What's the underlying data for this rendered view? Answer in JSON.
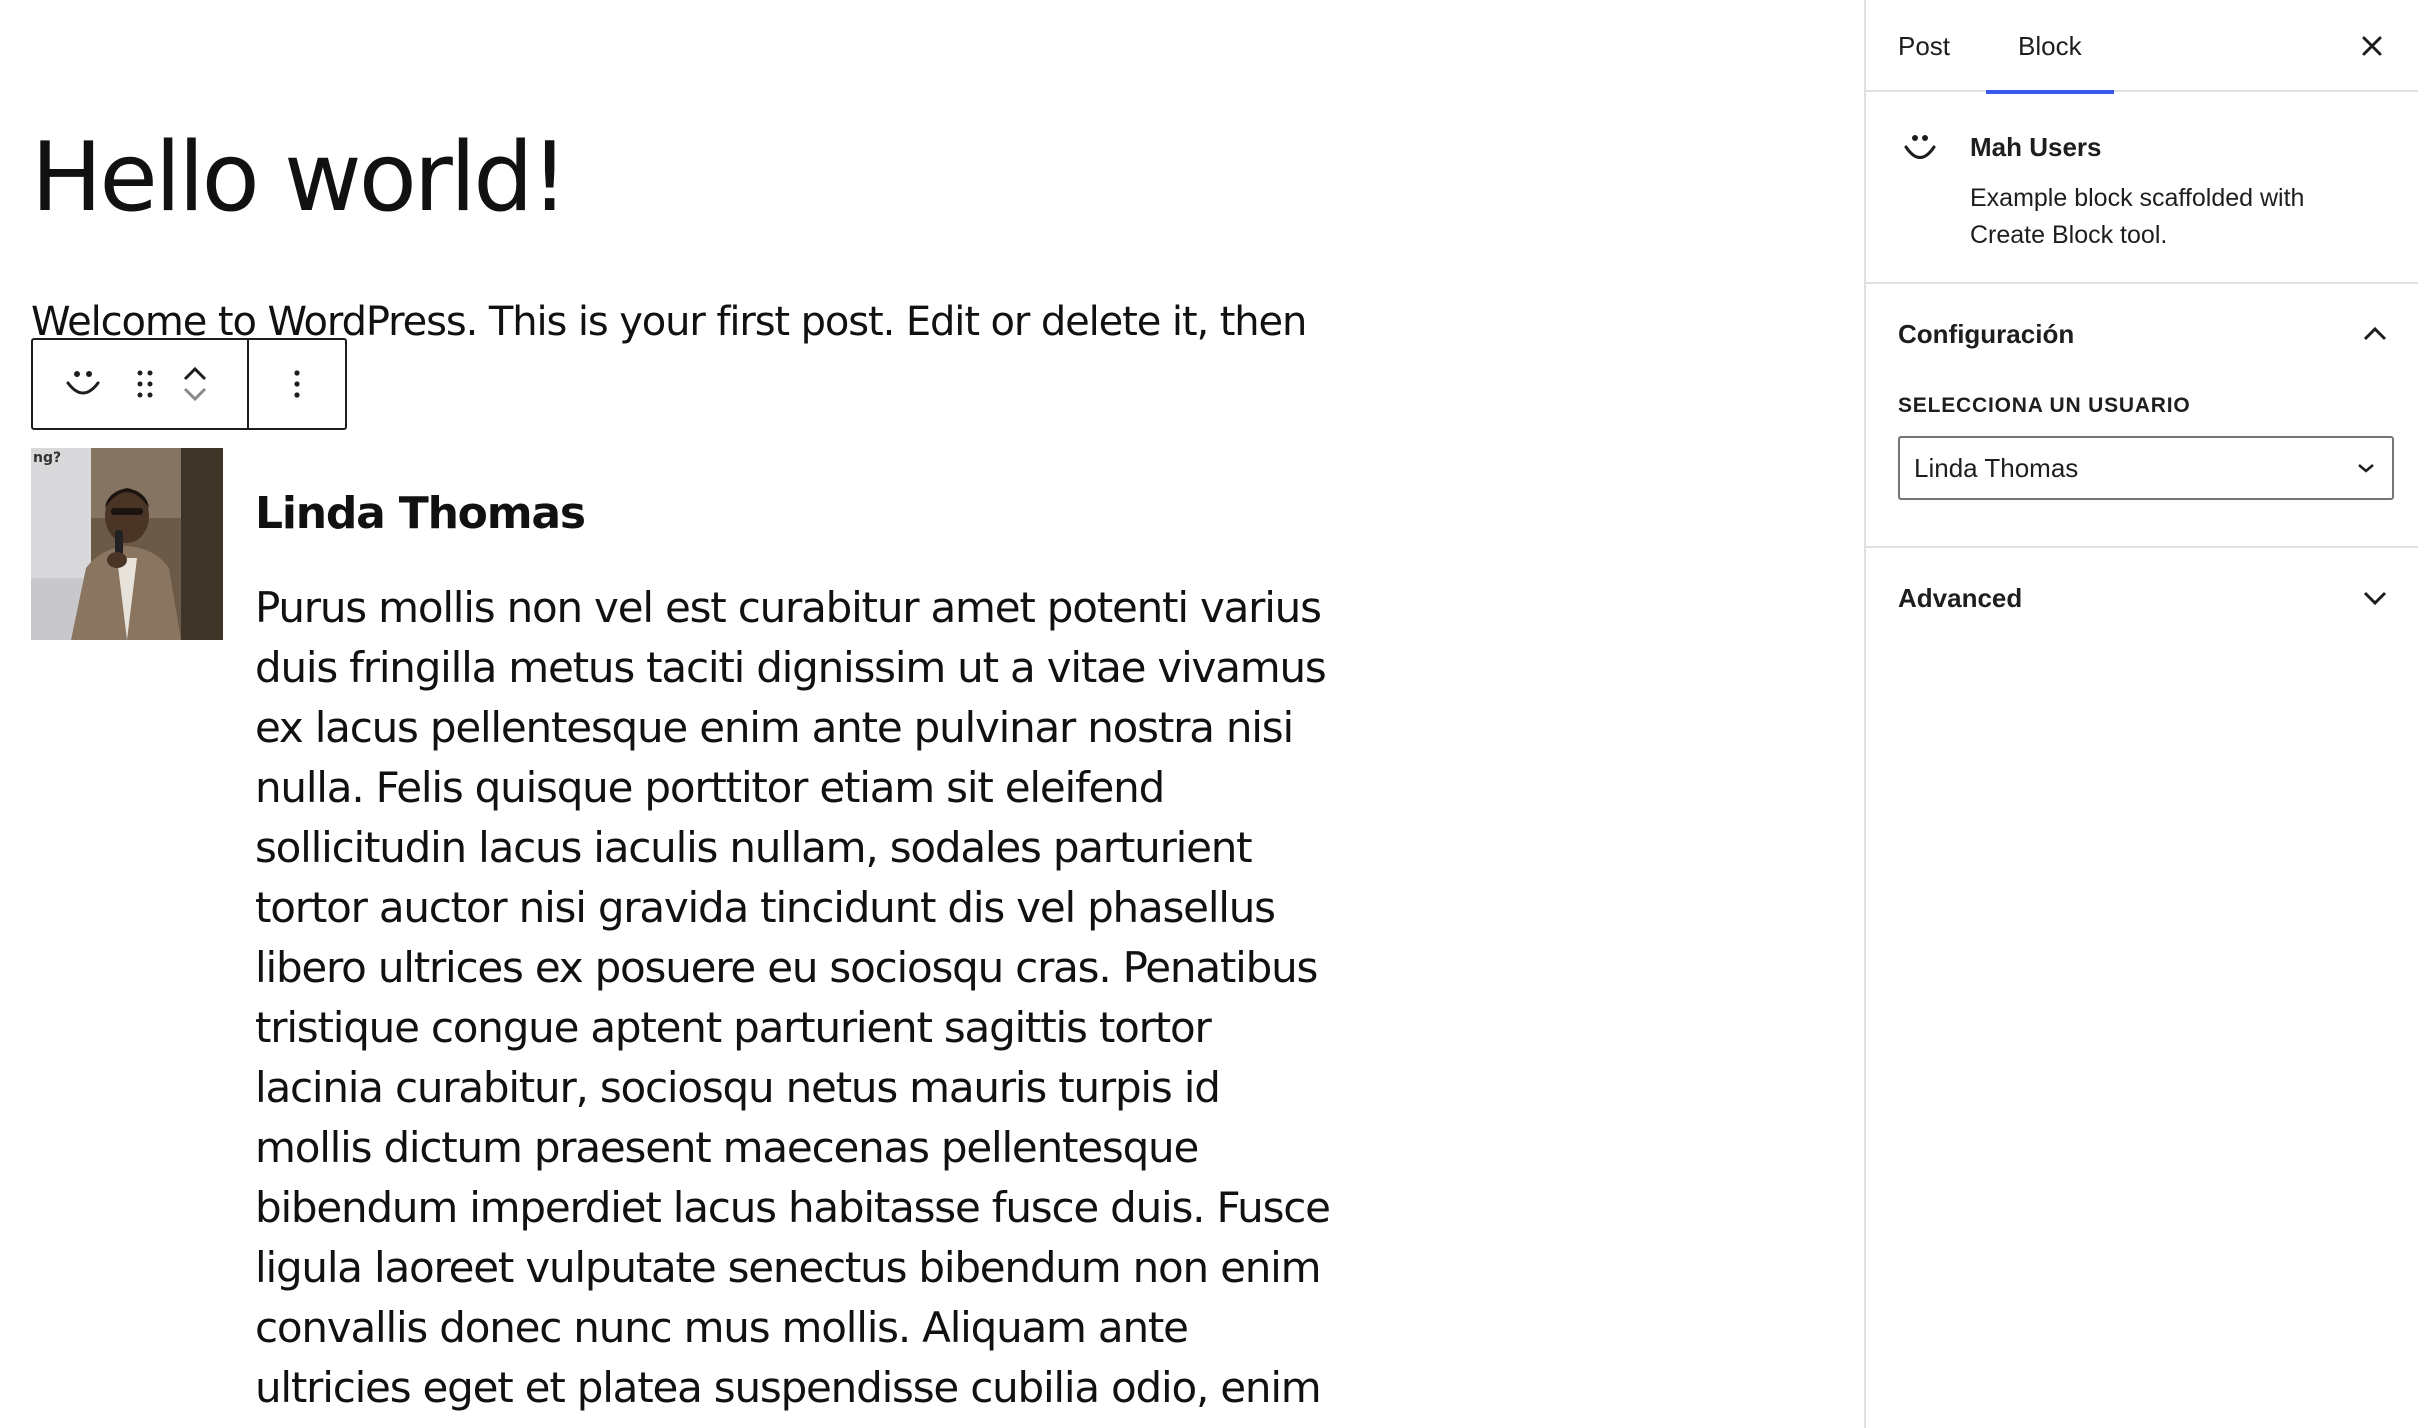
{
  "post": {
    "title": "Hello world!",
    "intro": "Welcome to WordPress. This is your first post. Edit or delete it, then"
  },
  "user_block": {
    "name": "Linda Thomas",
    "bio": "Purus mollis non vel est curabitur amet potenti varius duis fringilla metus taciti dignissim ut a vitae vivamus ex lacus pellentesque enim ante pulvinar nostra nisi nulla. Felis quisque porttitor etiam sit eleifend sollicitudin lacus iaculis nullam, sodales parturient tortor auctor nisi gravida tincidunt dis vel phasellus libero ultrices ex posuere eu sociosqu cras. Penatibus tristique congue aptent parturient sagittis tortor lacinia curabitur, sociosqu netus mauris turpis id mollis dictum praesent maecenas pellentesque bibendum imperdiet lacus habitasse fusce duis. Fusce ligula laoreet vulputate senectus bibendum non enim convallis donec nunc mus mollis. Aliquam ante ultricies eget et platea suspendisse cubilia odio, enim nibh senectus phasellus",
    "avatar_corner_text": "ng?"
  },
  "toolbar": {
    "icons": [
      "smiley-block-icon",
      "drag-handle-icon",
      "move-up-icon",
      "move-down-icon",
      "more-options-icon"
    ]
  },
  "sidebar": {
    "tabs": [
      "Post",
      "Block"
    ],
    "active_tab": "Block",
    "block_card": {
      "title": "Mah Users",
      "description": "Example block scaffolded with Create Block tool."
    },
    "config_panel": {
      "title": "Configuración",
      "field_label": "SELECCIONA UN USUARIO",
      "selected_user": "Linda Thomas"
    },
    "advanced_panel": {
      "title": "Advanced"
    }
  },
  "colors": {
    "accent": "#3858e9",
    "text": "#1e1e1e",
    "border": "#e0e0e0"
  }
}
